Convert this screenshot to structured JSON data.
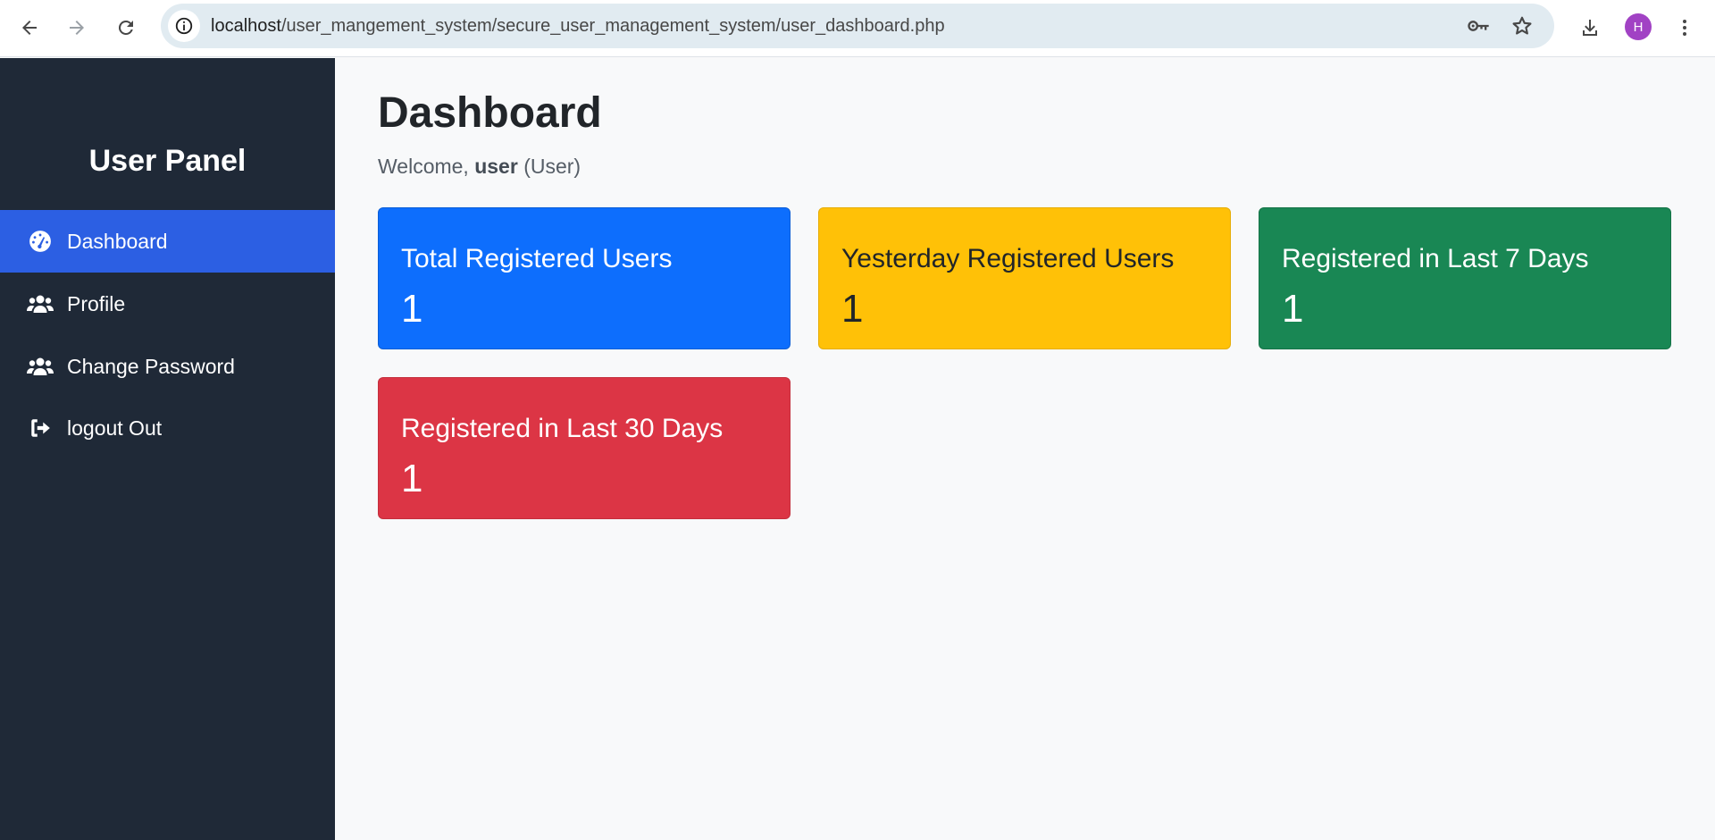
{
  "browser": {
    "url_host": "localhost",
    "url_path": "/user_mangement_system/secure_user_management_system/user_dashboard.php",
    "profile_initial": "H",
    "icons": {
      "back": "arrow-left-icon",
      "forward": "arrow-right-icon",
      "reload": "reload-icon",
      "site_info": "info-icon",
      "password": "key-icon",
      "bookmark": "star-icon",
      "download": "download-icon",
      "menu": "more-vertical-icon"
    },
    "colors": {
      "omnibox": "#e1ebf1",
      "avatar": "#a142c4"
    }
  },
  "sidebar": {
    "brand": "User Panel",
    "items": [
      {
        "label": "Dashboard",
        "icon": "gauge-icon",
        "active": true
      },
      {
        "label": "Profile",
        "icon": "users-icon",
        "active": false
      },
      {
        "label": "Change Password",
        "icon": "users-icon",
        "active": false
      },
      {
        "label": "logout Out",
        "icon": "sign-out-icon",
        "active": false
      }
    ],
    "colors": {
      "background": "#1f2937",
      "active": "#2c5fe3"
    }
  },
  "main": {
    "title": "Dashboard",
    "welcome_prefix": "Welcome,",
    "welcome_user": "user",
    "welcome_role": "(User)",
    "cards": [
      {
        "title": "Total Registered Users",
        "value": "1",
        "color": "#0d6efd"
      },
      {
        "title": "Yesterday Registered Users",
        "value": "1",
        "color": "#ffc107"
      },
      {
        "title": "Registered in Last 7 Days",
        "value": "1",
        "color": "#198754"
      },
      {
        "title": "Registered in Last 30 Days",
        "value": "1",
        "color": "#dc3545"
      }
    ]
  }
}
